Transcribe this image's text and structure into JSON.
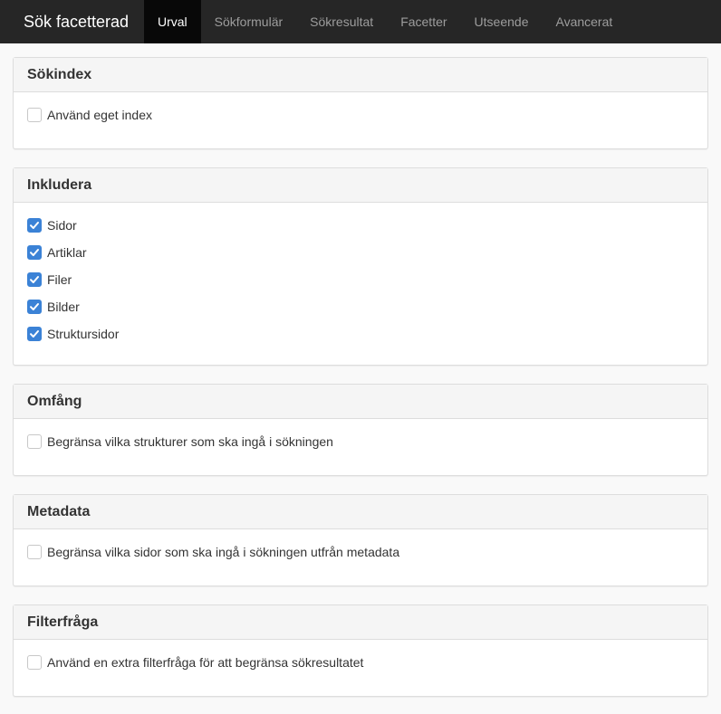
{
  "navbar": {
    "brand": "Sök facetterad",
    "tabs": [
      {
        "label": "Urval",
        "active": true
      },
      {
        "label": "Sökformulär",
        "active": false
      },
      {
        "label": "Sökresultat",
        "active": false
      },
      {
        "label": "Facetter",
        "active": false
      },
      {
        "label": "Utseende",
        "active": false
      },
      {
        "label": "Avancerat",
        "active": false
      }
    ]
  },
  "panels": {
    "sokindex": {
      "title": "Sökindex",
      "options": [
        {
          "label": "Använd eget index",
          "checked": false
        }
      ]
    },
    "inkludera": {
      "title": "Inkludera",
      "options": [
        {
          "label": "Sidor",
          "checked": true
        },
        {
          "label": "Artiklar",
          "checked": true
        },
        {
          "label": "Filer",
          "checked": true
        },
        {
          "label": "Bilder",
          "checked": true
        },
        {
          "label": "Struktursidor",
          "checked": true
        }
      ]
    },
    "omfang": {
      "title": "Omfång",
      "options": [
        {
          "label": "Begränsa vilka strukturer som ska ingå i sökningen",
          "checked": false
        }
      ]
    },
    "metadata": {
      "title": "Metadata",
      "options": [
        {
          "label": "Begränsa vilka sidor som ska ingå i sökningen utfrån metadata",
          "checked": false
        }
      ]
    },
    "filterfraga": {
      "title": "Filterfråga",
      "options": [
        {
          "label": "Använd en extra filterfråga för att begränsa sökresultatet",
          "checked": false
        }
      ]
    }
  },
  "colors": {
    "navbar_bg": "#262626",
    "active_tab_bg": "#080808",
    "checkbox_accent": "#3b82d6"
  },
  "icons": {
    "check": "check-icon"
  }
}
